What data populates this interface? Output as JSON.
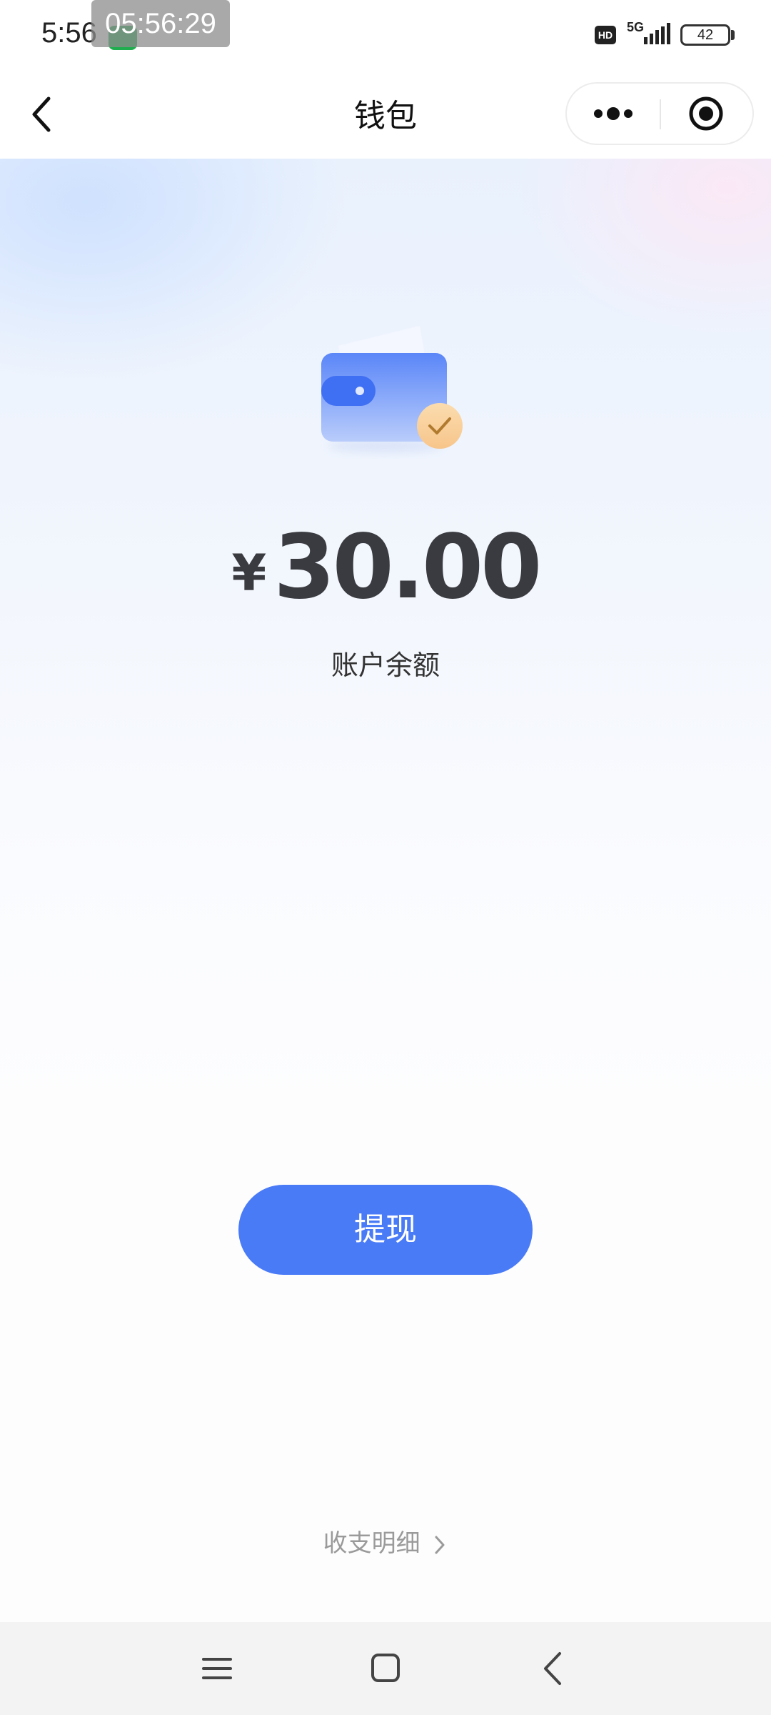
{
  "status_bar": {
    "time": "5:56",
    "call_timer": "05:56:29",
    "hd_badge": "HD",
    "network": "5G",
    "battery": "42"
  },
  "nav": {
    "title": "钱包",
    "icons": {
      "back": "chevron-left-icon",
      "more": "more-dots-icon",
      "close": "target-circle-icon"
    }
  },
  "wallet": {
    "currency_symbol": "¥",
    "amount": "30.00",
    "balance_label": "账户余额"
  },
  "actions": {
    "withdraw_label": "提现",
    "details_label": "收支明细"
  },
  "colors": {
    "primary": "#4a7bf7",
    "amount_text": "#3a3b40",
    "muted_text": "#9a9a9a",
    "check_badge": "#f5c98a"
  },
  "system_nav": [
    "menu-icon",
    "home-icon",
    "back-icon"
  ]
}
